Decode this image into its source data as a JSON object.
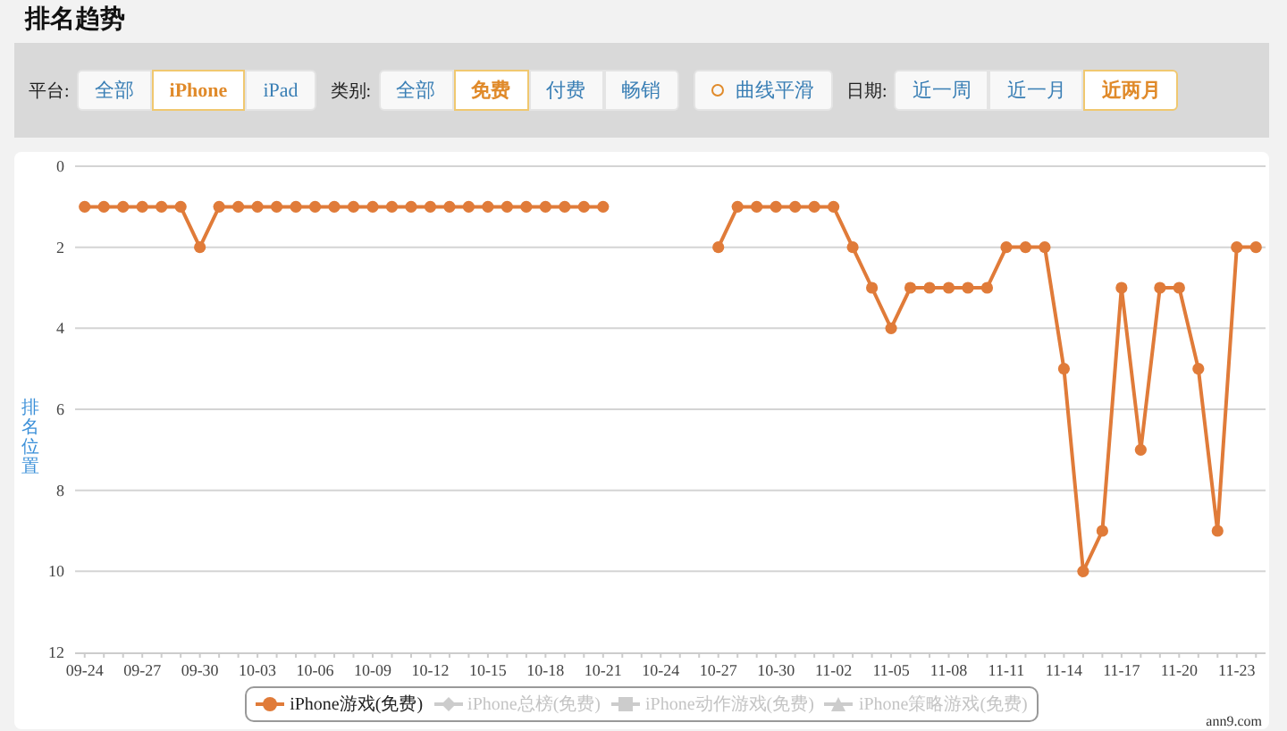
{
  "title": "排名趋势",
  "filters": [
    {
      "kind": "group",
      "label": "平台:",
      "options": [
        {
          "label": "全部",
          "selected": false
        },
        {
          "label": "iPhone",
          "selected": true
        },
        {
          "label": "iPad",
          "selected": false
        }
      ]
    },
    {
      "kind": "group",
      "label": "类别:",
      "options": [
        {
          "label": "全部",
          "selected": false
        },
        {
          "label": "免费",
          "selected": true
        },
        {
          "label": "付费",
          "selected": false
        },
        {
          "label": "畅销",
          "selected": false
        }
      ]
    },
    {
      "kind": "toggle",
      "label": "曲线平滑",
      "on": false
    },
    {
      "kind": "group",
      "label": "日期:",
      "options": [
        {
          "label": "近一周",
          "selected": false
        },
        {
          "label": "近一月",
          "selected": false
        },
        {
          "label": "近两月",
          "selected": true
        }
      ]
    }
  ],
  "chart": {
    "chart_data": {
      "type": "line",
      "ylabel": "排名位置",
      "ylim": [
        12,
        0
      ],
      "grid": true,
      "yticks": [
        0,
        2,
        4,
        6,
        8,
        10,
        12
      ],
      "categories": [
        "09-24",
        null,
        null,
        "09-27",
        null,
        null,
        "09-30",
        null,
        null,
        "10-03",
        null,
        null,
        "10-06",
        null,
        null,
        "10-09",
        null,
        null,
        "10-12",
        null,
        null,
        "10-15",
        null,
        null,
        "10-18",
        null,
        null,
        "10-21",
        null,
        null,
        "10-24",
        null,
        null,
        "10-27",
        null,
        null,
        "10-30",
        null,
        null,
        "11-02",
        null,
        null,
        "11-05",
        null,
        null,
        "11-08",
        null,
        null,
        "11-11",
        null,
        null,
        "11-14",
        null,
        null,
        "11-17",
        null,
        null,
        "11-20",
        null,
        null,
        "11-23",
        null
      ],
      "series": [
        {
          "name": "iPhone游戏(免费)",
          "color": "#e07b39",
          "marker": "circle",
          "values": [
            1,
            1,
            1,
            1,
            1,
            1,
            2,
            1,
            1,
            1,
            1,
            1,
            1,
            1,
            1,
            1,
            1,
            1,
            1,
            1,
            1,
            1,
            1,
            1,
            1,
            1,
            1,
            1,
            null,
            null,
            null,
            null,
            null,
            2,
            1,
            1,
            1,
            1,
            1,
            1,
            2,
            3,
            4,
            3,
            3,
            3,
            3,
            3,
            2,
            2,
            2,
            5,
            10,
            9,
            3,
            7,
            3,
            3,
            5,
            9,
            2,
            2
          ]
        }
      ]
    },
    "legend": [
      {
        "kind": "circle",
        "visible": true
      },
      {
        "label": "iPhone总榜(免费)",
        "kind": "diamond",
        "visible": false
      },
      {
        "label": "iPhone动作游戏(免费)",
        "kind": "square",
        "visible": false
      },
      {
        "label": "iPhone策略游戏(免费)",
        "kind": "triangle",
        "visible": false
      }
    ],
    "credit": "ann9.com"
  }
}
